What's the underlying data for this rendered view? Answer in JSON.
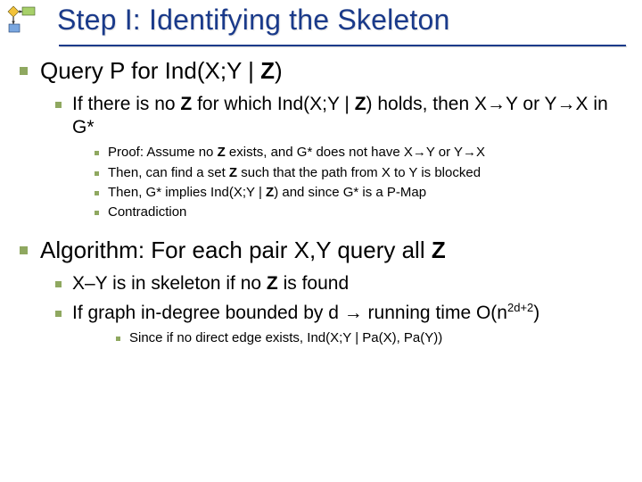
{
  "title": "Step I: Identifying the Skeleton",
  "s1": {
    "head_pre": "Query P for Ind(X;Y | ",
    "head_bold": "Z",
    "head_post": ")",
    "l2a_pre": "If there is no ",
    "l2a_b1": "Z",
    "l2a_mid": " for which Ind(X;Y | ",
    "l2a_b2": "Z",
    "l2a_post": ") holds, then X→Y or Y→X in G*",
    "p1_pre": "Proof: Assume no ",
    "p1_b": "Z",
    "p1_post": " exists, and G* does not have X→Y or Y→X",
    "p2_pre": "Then, can find a set ",
    "p2_b": "Z",
    "p2_post": " such that the path from X to Y is blocked",
    "p3_pre": "Then, G* implies Ind(X;Y | ",
    "p3_b": "Z",
    "p3_post": ") and since G* is a P-Map",
    "p4": "Contradiction"
  },
  "s2": {
    "head_pre": "Algorithm: For each pair X,Y query all ",
    "head_bold": "Z",
    "l2a_pre": "X–Y is in skeleton if no ",
    "l2a_b": "Z",
    "l2a_post": " is found",
    "l2b_pre": "If graph in-degree bounded by d → running time O(n",
    "l2b_sup": "2d+2",
    "l2b_post": ")",
    "p1": "Since if no direct edge exists, Ind(X;Y | Pa(X), Pa(Y))"
  }
}
